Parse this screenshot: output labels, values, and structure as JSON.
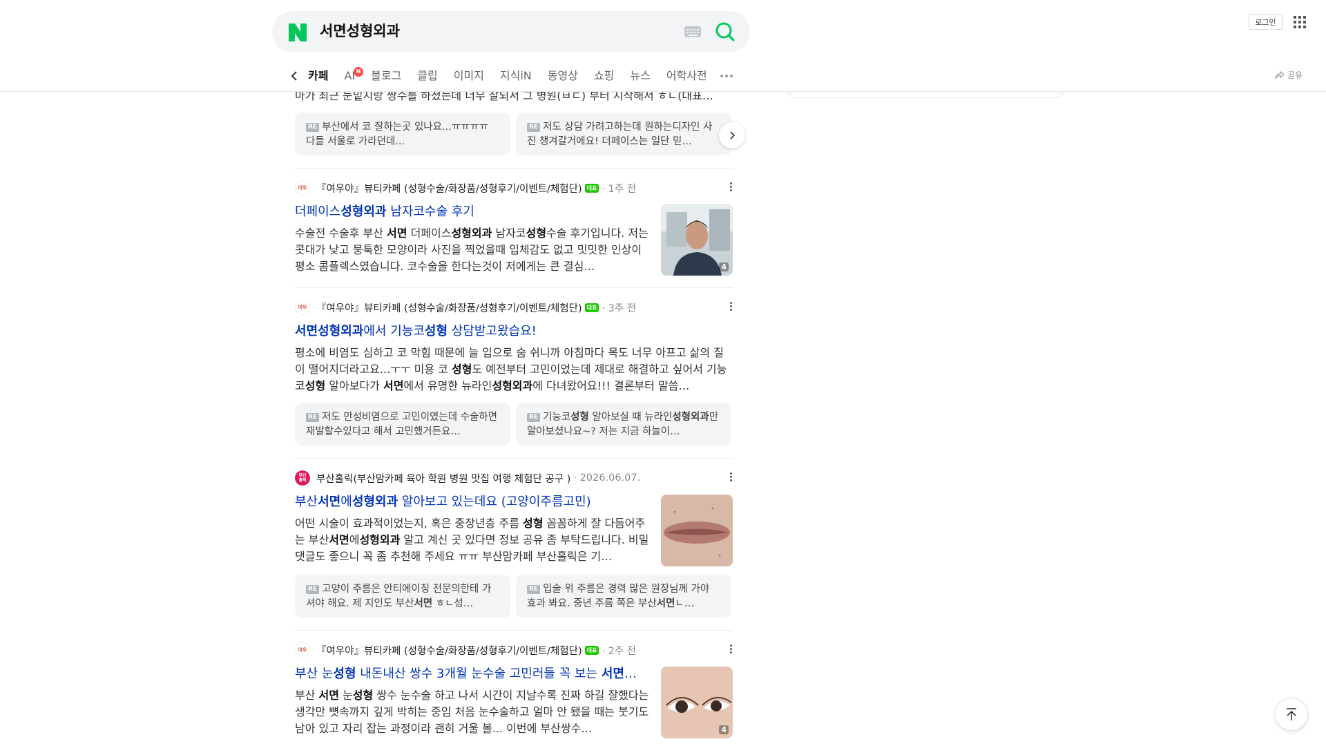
{
  "search": {
    "query": "서면성형외과",
    "logo": "N"
  },
  "header": {
    "login_label": "로그인",
    "share_label": "공유"
  },
  "tabs": [
    {
      "label": "카페",
      "active": true
    },
    {
      "label": "AI",
      "badge": "N"
    },
    {
      "label": "블로그"
    },
    {
      "label": "클립"
    },
    {
      "label": "이미지"
    },
    {
      "label": "지식iN"
    },
    {
      "label": "동영상"
    },
    {
      "label": "쇼핑"
    },
    {
      "label": "뉴스"
    },
    {
      "label": "어학사전"
    }
  ],
  "top_snippet": "마가 최근 눈밑지랑 쌍수를 하셨는데 너무 잘되서 그 병원(ㅂㄷ) 부터 시작해서 ㅎㄴ(대표…",
  "top_replies": [
    "부산에서 코 잘하는곳 있나요...ㅠㅠㅠㅠ 다들 서울로 가라던데...",
    "저도 상담 가려고하는데 원하는디자인 사진 챙겨갈거에요! 더페이스는 일단 믿…"
  ],
  "posts": [
    {
      "source": "『여우야』뷰티카페 (성형수술/화장품/성형후기/이벤트/체험단)",
      "badge": "대표",
      "date": "1주 전",
      "title_parts": [
        [
          "더페이스",
          false
        ],
        [
          "성형외과",
          true
        ],
        [
          " 남자코수술 후기",
          false
        ]
      ],
      "body_html": "수술전 수술후 부산 <b>서면</b> 더페이스<b>성형외과</b> 남자코<b>성형</b>수술 후기입니다. 저는 콧대가 낮고 뭉툭한 모양이라 사진을 찍었을때 입체감도 없고 밋밋한 인상이 평소 콤플렉스였습니다. 코수술을 한다는것이 저에게는 큰 결심…",
      "thumb_count": "4"
    },
    {
      "source": "『여우야』뷰티카페 (성형수술/화장품/성형후기/이벤트/체험단)",
      "badge": "대표",
      "date": "3주 전",
      "title_parts": [
        [
          "서면성형외과",
          true
        ],
        [
          "에서 기능코",
          false
        ],
        [
          "성형",
          true
        ],
        [
          " 상담받고왔습요!",
          false
        ]
      ],
      "body_html": "평소에 비염도 심하고 코 막힘 때문에 늘 입으로 숨 쉬니까 아침마다 목도 너무 아프고 삶의 질이 떨어지더라고요...ㅜㅜ 미용 코 <b>성형</b>도 예전부터 고민이었는데 제대로 해결하고 싶어서 기능코<b>성형</b> 알아보다가 <b>서면</b>에서 유명한 뉴라인<b>성형외과</b>에 다녀왔어요!!! 결론부터 말씀…",
      "replies": [
        "저도 만성비염으로 고민이였는데 수술하면 재발할수있다고 해서 고민했거든요…",
        "기능코<b>성형</b> 알아보실 때 뉴라인<b>성형외과</b>만 알아보셨나요~? 저는 지금 하늘이…"
      ]
    },
    {
      "source": "부산홀릭(부산맘카페 육아 학원 병원 맛집 여행 체험단 공구 )",
      "date": "2026.06.07.",
      "title_parts": [
        [
          "부산",
          false
        ],
        [
          "서면",
          true
        ],
        [
          "에",
          false
        ],
        [
          "성형외과",
          true
        ],
        [
          " 알아보고 있는데요 (고양이주름고민)",
          false
        ]
      ],
      "body_html": "어떤 시술이 효과적이었는지, 혹은 중장년층 주름 <b>성형</b> 꼼꼼하게 잘 다듬어주는 부산<b>서면</b>에<b>성형외과</b> 알고 계신 곳 있다면 정보 공유 좀 부탁드립니다. 비밀댓글도 좋으니 꼭 좀 추천해 주세요 ㅠㅠ 부산맘카페 부산홀릭은 기…",
      "replies": [
        "고양이 주름은 안티에이징 전문의한테 가셔야 해요. 제 지인도 부산<b>서면</b> ㅎㄴ성…",
        "입술 위 주름은 경력 많은 원장님께 가야 효과 봐요. 중년 주름 쪽은 부산<b>서면</b>ㄴ…"
      ]
    },
    {
      "source": "『여우야』뷰티카페 (성형수술/화장품/성형후기/이벤트/체험단)",
      "badge": "대표",
      "date": "2주 전",
      "title_parts": [
        [
          "부산 눈",
          false
        ],
        [
          "성형",
          true
        ],
        [
          " 내돈내산 쌍수 3개월 눈수술 고민러들 꼭 보는 ",
          false
        ],
        [
          "서면",
          true
        ],
        [
          "…",
          false
        ]
      ],
      "body_html": "부산 <b>서면</b> 눈<b>성형</b> 쌍수 눈수술 하고 나서 시간이 지날수록 진짜 하길 잘했다는 생각만 뼛속까지 깊게 박히는 중임 처음 눈수술하고 얼마 안 됐을 때는 붓기도 남아 있고 자리 잡는 과정이라 괜히 거울 볼... 이번에 부산쌍수…",
      "thumb_count": "4"
    }
  ],
  "colors": {
    "naver_green": "#03c75a",
    "link_blue": "#0034b5",
    "brand": "#1ec800"
  }
}
